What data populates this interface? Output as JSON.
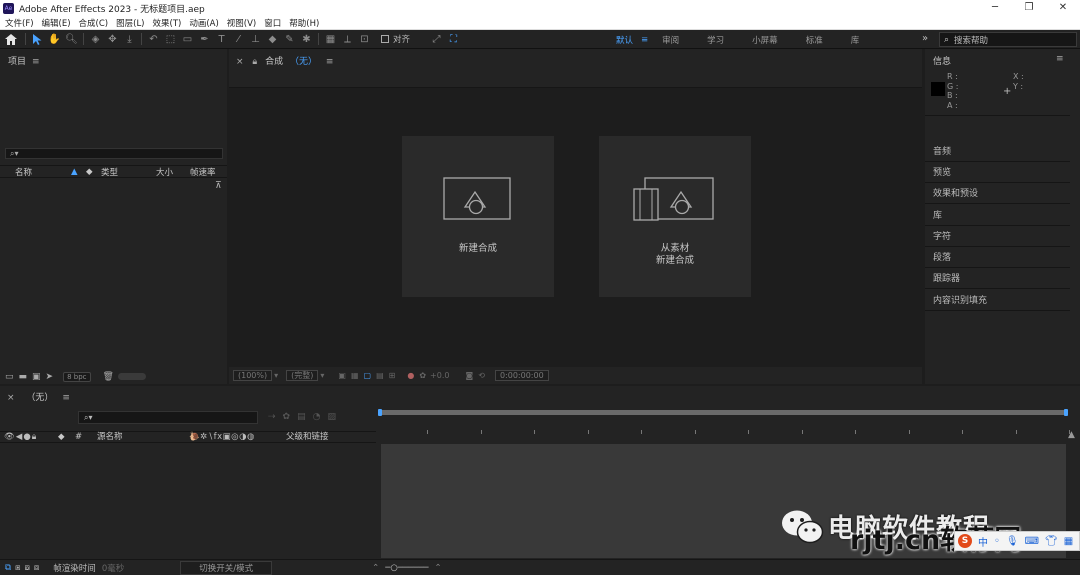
{
  "window": {
    "title": "Adobe After Effects 2023 - 无标题项目.aep",
    "app_badge": "Ae"
  },
  "menu": [
    "文件(F)",
    "编辑(E)",
    "合成(C)",
    "图层(L)",
    "效果(T)",
    "动画(A)",
    "视图(V)",
    "窗口",
    "帮助(H)"
  ],
  "toolbar": {
    "align_label": "对齐",
    "workspaces": [
      "默认",
      "审阅",
      "学习",
      "小屏幕",
      "标准",
      "库"
    ],
    "active_workspace": "默认",
    "help_search_placeholder": "搜索帮助"
  },
  "project": {
    "title": "项目",
    "search_placeholder": "",
    "columns": {
      "name": "名称",
      "type": "类型",
      "size": "大小",
      "fps": "帧速率"
    },
    "bpc": "8 bpc"
  },
  "composition": {
    "tab_prefix": "合成",
    "tab_name": "（无）",
    "new_comp": "新建合成",
    "from_footage_line1": "从素材",
    "from_footage_line2": "新建合成",
    "zoom": "(100%)",
    "resolution": "(完整)",
    "exposure": "+0.0",
    "timecode": "0:00:00:00"
  },
  "info": {
    "title": "信息",
    "channels": [
      "R :",
      "G :",
      "B :",
      "A :"
    ],
    "coords": [
      "X :",
      "Y :"
    ],
    "panels": [
      "音频",
      "预览",
      "效果和预设",
      "库",
      "字符",
      "段落",
      "跟踪器",
      "内容识别填充"
    ]
  },
  "timeline": {
    "tab_name": "（无）",
    "columns": {
      "source": "源名称",
      "parent": "父级和链接"
    },
    "footer_render": "帧渲染时间",
    "footer_ms": "0毫秒",
    "footer_toggle": "切换开关/模式"
  },
  "watermark": {
    "text": "电脑软件教程",
    "site": "rjtj.cn软荐网"
  },
  "ime": {
    "lang": "中"
  }
}
